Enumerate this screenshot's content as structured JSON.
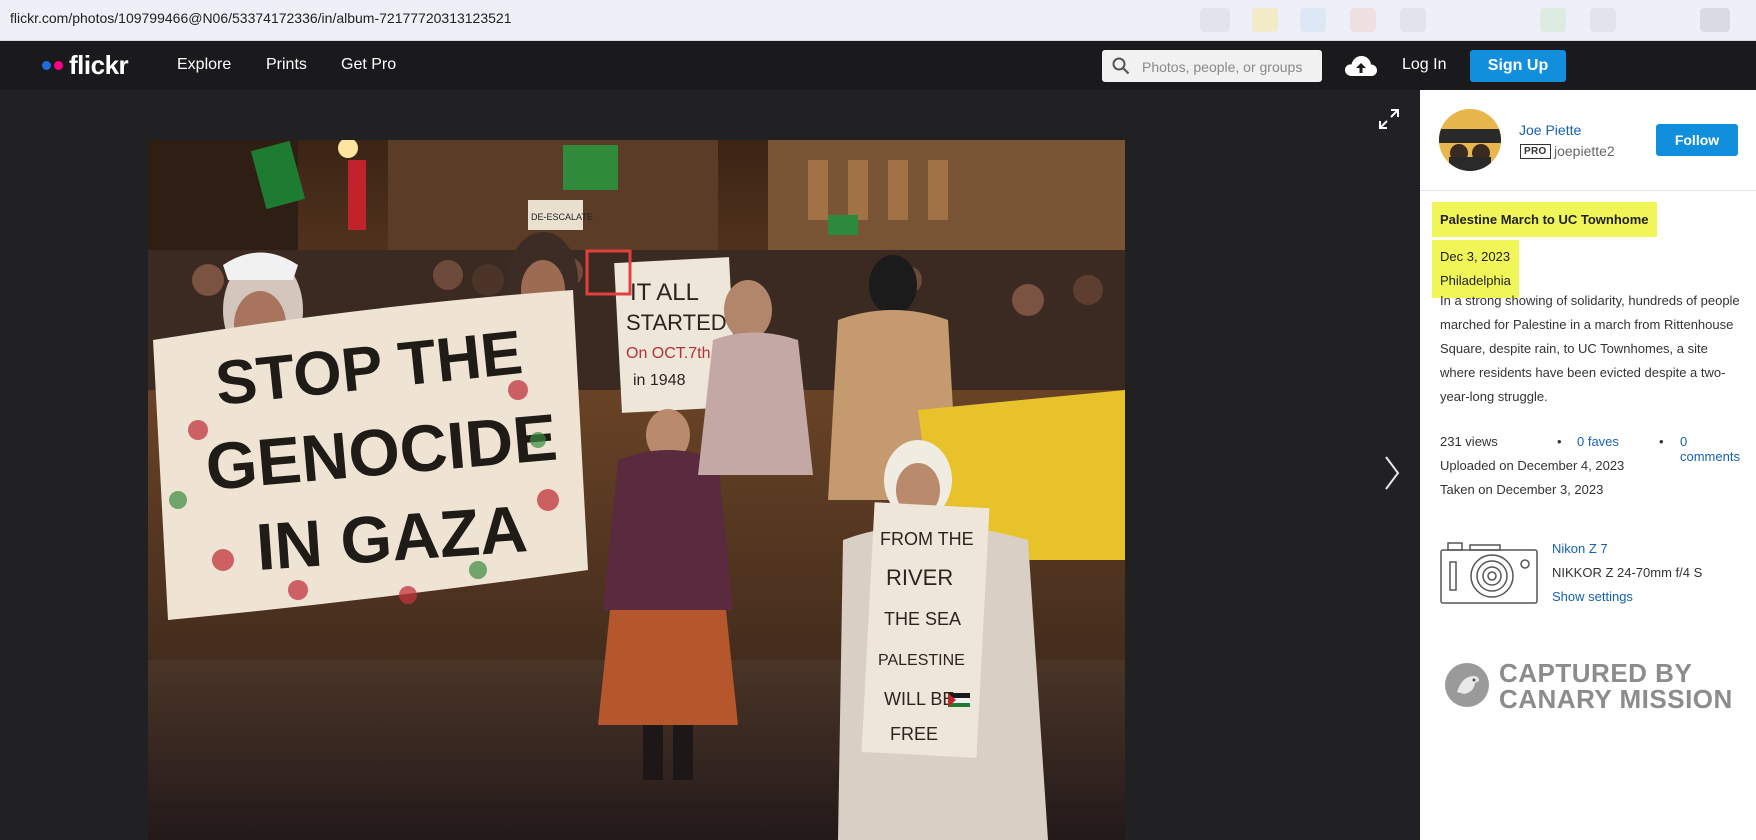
{
  "browser": {
    "url": "flickr.com/photos/109799466@N06/53374172336/in/album-72177720313123521"
  },
  "nav": {
    "logo": "flickr",
    "links": [
      "Explore",
      "Prints",
      "Get Pro"
    ],
    "search_placeholder": "Photos, people, or groups",
    "login": "Log In",
    "signup": "Sign Up",
    "colors": {
      "brand_blue": "#1f6ce0",
      "brand_pink": "#ff0084",
      "button_blue": "#128fdc"
    }
  },
  "photo": {
    "banner_text": [
      "STOP THE",
      "GENOCIDE",
      "IN GAZA"
    ],
    "sign_center": [
      "IT ALL",
      "STARTED",
      "On OCT.7th",
      "in 1948"
    ],
    "sign_right": [
      "FROM THE",
      "RIVER",
      "THE SEA",
      "PALESTINE",
      "WILL BE",
      "FREE"
    ],
    "street_sign": "DE-ESCALATE",
    "icons": [
      "expand-icon",
      "next-arrow-icon"
    ],
    "highlight_box_color": "#e0403f"
  },
  "sidebar": {
    "owner_name": "Joe Piette",
    "pro_badge": "PRO",
    "owner_handle": "joepiette2",
    "follow": "Follow",
    "title": "Palestine March to UC Townhome",
    "date": "Dec 3, 2023",
    "location": "Philadelphia",
    "description": "In a strong showing of solidarity, hundreds of people marched for Palestine in a march from Rittenhouse Square, despite rain, to UC Townhomes, a site where residents have been evicted despite a two-year-long struggle.",
    "views": "231 views",
    "faves": "0 faves",
    "comments": "0 comments",
    "uploaded": "Uploaded on December 4, 2023",
    "taken": "Taken on December 3, 2023",
    "camera": "Nikon Z 7",
    "lens": "NIKKOR Z 24-70mm f/4 S",
    "show_settings": "Show settings",
    "watermark": [
      "CAPTURED BY",
      "CANARY MISSION"
    ],
    "highlight_color": "#f0f657"
  }
}
